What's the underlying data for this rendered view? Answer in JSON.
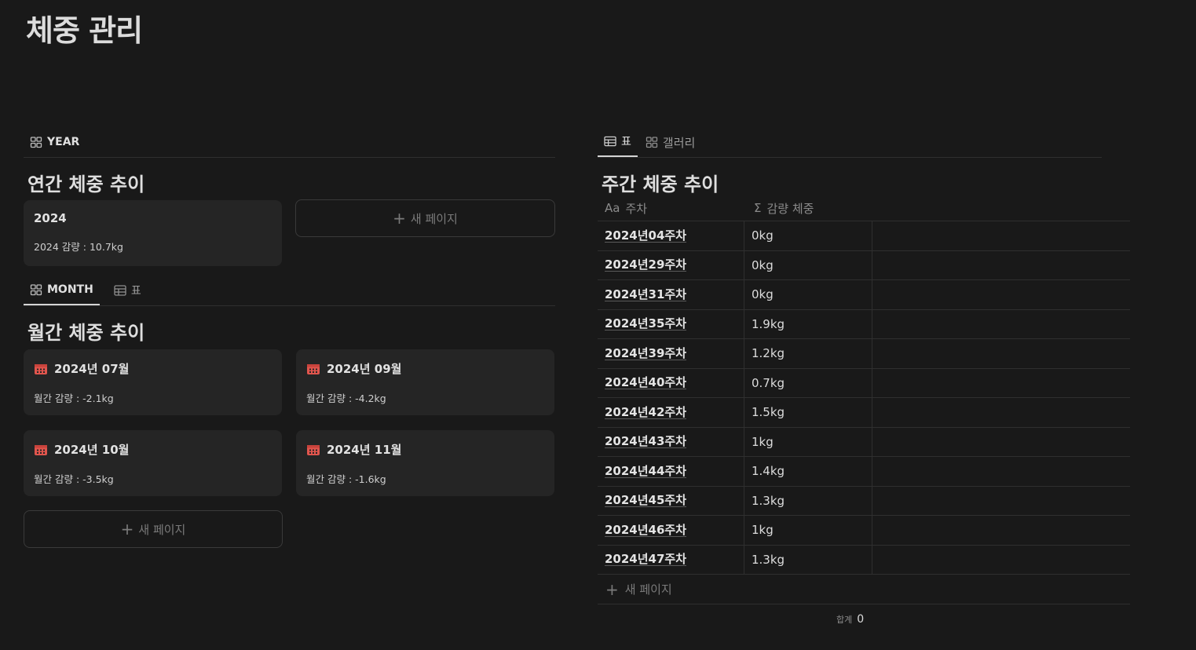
{
  "page": {
    "title": "체중 관리"
  },
  "year_section": {
    "tab_label": "YEAR",
    "title": "연간 체중 추이",
    "card": {
      "title": "2024",
      "subtitle": "2024 감량 : 10.7kg"
    },
    "new_page": "새 페이지"
  },
  "month_section": {
    "tabs": [
      {
        "label": "MONTH",
        "icon": "gallery-icon"
      },
      {
        "label": "표",
        "icon": "table-icon"
      }
    ],
    "title": "월간 체중 추이",
    "cards": [
      {
        "title": "2024년 07월",
        "subtitle": "월간 감량 : -2.1kg"
      },
      {
        "title": "2024년 09월",
        "subtitle": "월간 감량 : -4.2kg"
      },
      {
        "title": "2024년 10월",
        "subtitle": "월간 감량 : -3.5kg"
      },
      {
        "title": "2024년 11월",
        "subtitle": "월간 감량 : -1.6kg"
      }
    ],
    "new_page": "새 페이지"
  },
  "week_section": {
    "tabs": [
      {
        "label": "표",
        "icon": "table-icon"
      },
      {
        "label": "갤러리",
        "icon": "gallery-icon"
      }
    ],
    "title": "주간 체중 추이",
    "columns": [
      {
        "label": "주차",
        "icon_text": "Aa"
      },
      {
        "label": "감량 체중",
        "icon_text": "Σ"
      }
    ],
    "rows": [
      {
        "week": "2024년04주차",
        "loss": "0kg"
      },
      {
        "week": "2024년29주차",
        "loss": "0kg"
      },
      {
        "week": "2024년31주차",
        "loss": "0kg"
      },
      {
        "week": "2024년35주차",
        "loss": "1.9kg"
      },
      {
        "week": "2024년39주차",
        "loss": "1.2kg"
      },
      {
        "week": "2024년40주차",
        "loss": "0.7kg"
      },
      {
        "week": "2024년42주차",
        "loss": "1.5kg"
      },
      {
        "week": "2024년43주차",
        "loss": "1kg"
      },
      {
        "week": "2024년44주차",
        "loss": "1.4kg"
      },
      {
        "week": "2024년45주차",
        "loss": "1.3kg"
      },
      {
        "week": "2024년46주차",
        "loss": "1kg"
      },
      {
        "week": "2024년47주차",
        "loss": "1.3kg"
      }
    ],
    "new_page": "새 페이지",
    "sum_label": "합계",
    "sum_value": "0"
  },
  "colors": {
    "background": "#191919",
    "card": "#252525",
    "calendar_icon": "#e0554d"
  }
}
